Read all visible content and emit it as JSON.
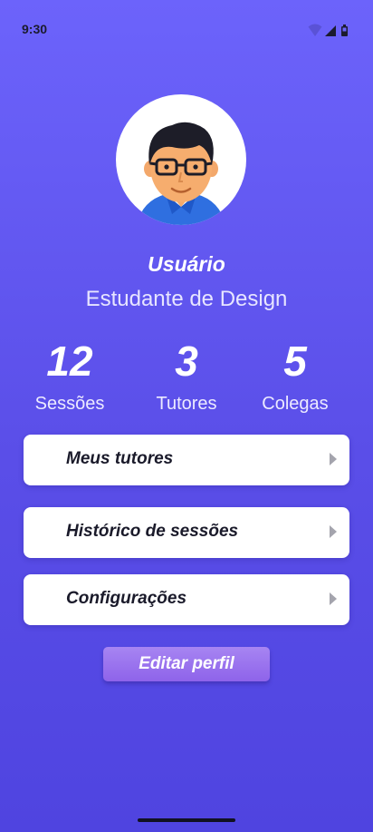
{
  "status_bar": {
    "time": "9:30"
  },
  "profile": {
    "name": "Usuário",
    "role": "Estudante de Design"
  },
  "stats": [
    {
      "value": "12",
      "label": "Sessões"
    },
    {
      "value": "3",
      "label": "Tutores"
    },
    {
      "value": "5",
      "label": "Colegas"
    }
  ],
  "menu": [
    {
      "label": "Meus tutores"
    },
    {
      "label": "Histórico de sessões"
    },
    {
      "label": "Configurações"
    }
  ],
  "actions": {
    "edit_label": "Editar perfil"
  },
  "icons": {
    "wifi": "wifi-icon",
    "signal": "signal-icon",
    "battery": "battery-icon",
    "chevron": "chevron-right-icon",
    "avatar": "user-avatar-illustration"
  },
  "colors": {
    "background_top": "#6c63fb",
    "background_bottom": "#4f44e0",
    "card": "#ffffff",
    "button": "#9b72ee",
    "text_dark": "#1a1a2a"
  }
}
